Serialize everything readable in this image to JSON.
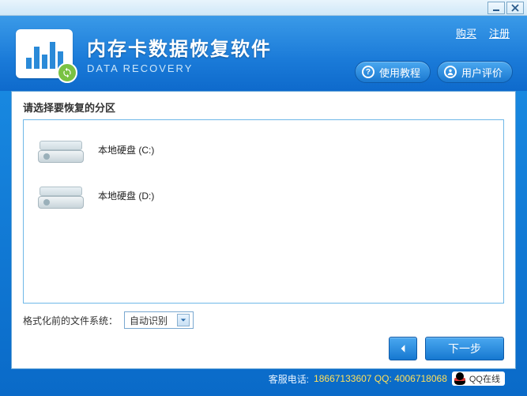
{
  "titlebar": {
    "minimize": "minimize",
    "close": "close"
  },
  "header": {
    "title_main": "内存卡数据恢复软件",
    "title_sub": "DATA RECOVERY",
    "link_buy": "购买",
    "link_register": "注册",
    "btn_tutorial": "使用教程",
    "btn_reviews": "用户评价"
  },
  "panel": {
    "title": "请选择要恢复的分区",
    "drives": [
      {
        "label": "本地硬盘 (C:)"
      },
      {
        "label": "本地硬盘 (D:)"
      }
    ],
    "fs_label": "格式化前的文件系统：",
    "fs_selected": "自动识别",
    "next_label": "下一步"
  },
  "footer": {
    "prefix": "客服电话:",
    "phone": "18667133607 QQ: 4006718068",
    "qq_label": "QQ在线"
  }
}
